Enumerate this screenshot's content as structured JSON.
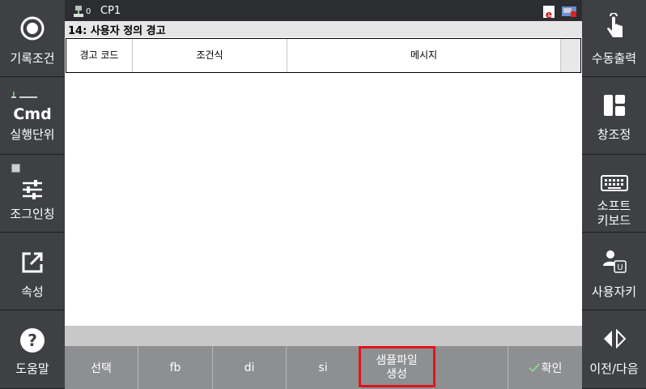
{
  "topbar": {
    "coord_index": "0",
    "cp_label": "CP1",
    "e_badge": "e"
  },
  "title": "14: 사용자 정의 경고",
  "table": {
    "columns": [
      "경고 코드",
      "조건식",
      "메시지"
    ]
  },
  "left_menu": [
    {
      "label": "기록조건",
      "icon": "record-circle-icon"
    },
    {
      "label": "실행단위",
      "icon": "cmd-icon",
      "icon_text": "Cmd"
    },
    {
      "label": "조그인칭",
      "icon": "sliders-icon"
    },
    {
      "label": "속성",
      "icon": "external-link-icon"
    },
    {
      "label": "도움말",
      "icon": "help-icon"
    }
  ],
  "right_menu": [
    {
      "label": "수동출력",
      "icon": "touch-hand-icon"
    },
    {
      "label": "창조정",
      "icon": "window-layout-icon"
    },
    {
      "label": "소프트\n키보드",
      "label1": "소프트",
      "label2": "키보드",
      "icon": "keyboard-icon"
    },
    {
      "label": "사용자키",
      "icon": "user-key-icon"
    },
    {
      "label": "이전/다음",
      "icon": "prev-next-icon"
    }
  ],
  "bottom_buttons": [
    "선택",
    "fb",
    "di",
    "si",
    "샘플파일\n생성",
    "",
    "확인"
  ],
  "bottom": {
    "select": "선택",
    "fb": "fb",
    "di": "di",
    "si": "si",
    "sample_line1": "샘플파일",
    "sample_line2": "생성",
    "confirm": "확인"
  },
  "colors": {
    "highlight": "#e0141c",
    "sidebar": "#3e4044",
    "bottombar": "#8e8f91"
  }
}
